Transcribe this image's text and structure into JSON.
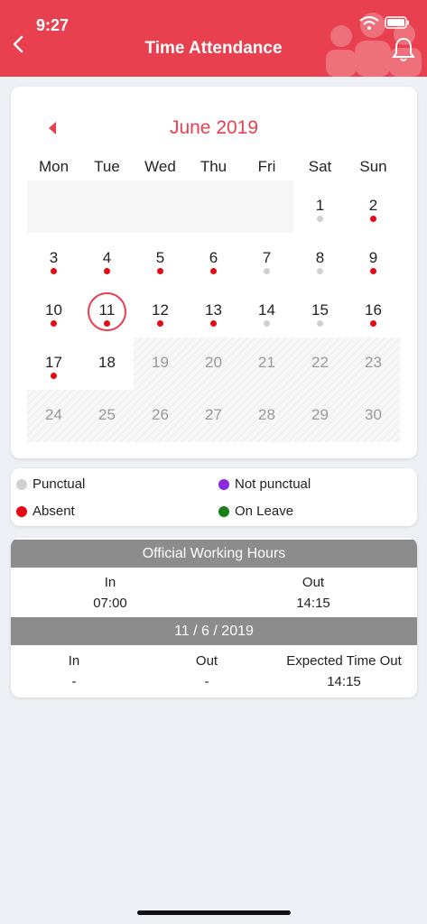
{
  "status_bar": {
    "time": "9:27"
  },
  "header": {
    "title": "Time Attendance"
  },
  "calendar": {
    "month_label": "June 2019",
    "weekdays": [
      "Mon",
      "Tue",
      "Wed",
      "Thu",
      "Fri",
      "Sat",
      "Sun"
    ],
    "selected_day": "11",
    "days": [
      {
        "day": "1",
        "status": "punctual"
      },
      {
        "day": "2",
        "status": "absent"
      },
      {
        "day": "3",
        "status": "absent"
      },
      {
        "day": "4",
        "status": "absent"
      },
      {
        "day": "5",
        "status": "absent"
      },
      {
        "day": "6",
        "status": "absent"
      },
      {
        "day": "7",
        "status": "punctual"
      },
      {
        "day": "8",
        "status": "punctual"
      },
      {
        "day": "9",
        "status": "absent"
      },
      {
        "day": "10",
        "status": "absent"
      },
      {
        "day": "11",
        "status": "absent"
      },
      {
        "day": "12",
        "status": "absent"
      },
      {
        "day": "13",
        "status": "absent"
      },
      {
        "day": "14",
        "status": "punctual"
      },
      {
        "day": "15",
        "status": "punctual"
      },
      {
        "day": "16",
        "status": "absent"
      },
      {
        "day": "17",
        "status": "absent"
      },
      {
        "day": "18",
        "status": "none"
      },
      {
        "day": "19",
        "status": "future"
      },
      {
        "day": "20",
        "status": "future"
      },
      {
        "day": "21",
        "status": "future"
      },
      {
        "day": "22",
        "status": "future"
      },
      {
        "day": "23",
        "status": "future"
      },
      {
        "day": "24",
        "status": "future"
      },
      {
        "day": "25",
        "status": "future"
      },
      {
        "day": "26",
        "status": "future"
      },
      {
        "day": "27",
        "status": "future"
      },
      {
        "day": "28",
        "status": "future"
      },
      {
        "day": "29",
        "status": "future"
      },
      {
        "day": "30",
        "status": "future"
      }
    ]
  },
  "legend": {
    "punctual": {
      "label": "Punctual",
      "color": "#d0d0d0"
    },
    "not_punctual": {
      "label": "Not punctual",
      "color": "#8a2be2"
    },
    "absent": {
      "label": "Absent",
      "color": "#e50914"
    },
    "on_leave": {
      "label": "On Leave",
      "color": "#1a7f1a"
    }
  },
  "working_hours": {
    "title": "Official Working Hours",
    "in_label": "In",
    "in_value": "07:00",
    "out_label": "Out",
    "out_value": "14:15"
  },
  "day_detail": {
    "date": "11 / 6 / 2019",
    "in_label": "In",
    "in_value": "-",
    "out_label": "Out",
    "out_value": "-",
    "expected_label": "Expected Time Out",
    "expected_value": "14:15"
  },
  "colors": {
    "accent": "#e8404f",
    "bar": "#8c8c8c"
  }
}
